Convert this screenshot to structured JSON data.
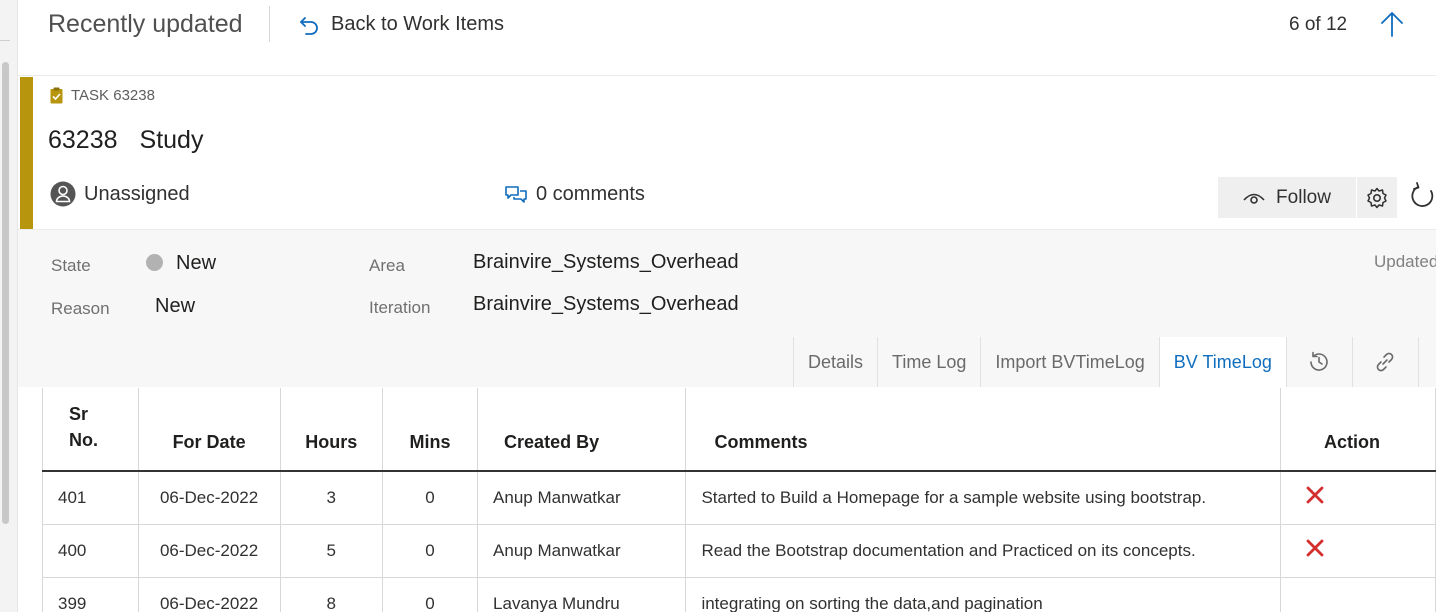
{
  "header": {
    "title": "Recently updated",
    "back_label": "Back to Work Items",
    "counter": "6 of 12"
  },
  "work_item": {
    "type_label": "TASK 63238",
    "id": "63238",
    "title": "Study",
    "assignee": "Unassigned",
    "comments": "0 comments",
    "follow_label": "Follow"
  },
  "fields": {
    "state_label": "State",
    "state_value": "New",
    "reason_label": "Reason",
    "reason_value": "New",
    "area_label": "Area",
    "area_value": "Brainvire_Systems_Overhead",
    "iteration_label": "Iteration",
    "iteration_value": "Brainvire_Systems_Overhead",
    "updated_label": "Updated"
  },
  "tabs": [
    {
      "label": "Details"
    },
    {
      "label": "Time Log"
    },
    {
      "label": "Import BVTimeLog"
    },
    {
      "label": "BV TimeLog",
      "active": true
    }
  ],
  "table": {
    "headers": {
      "sr_line1": "Sr",
      "sr_line2": "No.",
      "date": "For Date",
      "hours": "Hours",
      "mins": "Mins",
      "created_by": "Created By",
      "comments": "Comments",
      "action": "Action"
    },
    "rows": [
      {
        "sr": "401",
        "date": "06-Dec-2022",
        "hours": "3",
        "mins": "0",
        "created_by": "Anup Manwatkar",
        "comments": "Started to Build a Homepage for a sample website using bootstrap."
      },
      {
        "sr": "400",
        "date": "06-Dec-2022",
        "hours": "5",
        "mins": "0",
        "created_by": "Anup Manwatkar",
        "comments": "Read the Bootstrap documentation and Practiced on its concepts."
      },
      {
        "sr": "399",
        "date": "06-Dec-2022",
        "hours": "8",
        "mins": "0",
        "created_by": "Lavanya Mundru",
        "comments": "integrating on sorting the data,and pagination"
      }
    ]
  },
  "colors": {
    "task_accent": "#b7960e",
    "link_blue": "#0f6cbd",
    "delete_red": "#d32f2f"
  },
  "icons": {
    "back": "back-arrow-icon",
    "up": "up-arrow-icon",
    "task": "task-clipboard-icon",
    "assignee": "user-avatar-icon",
    "comments": "comments-icon",
    "follow": "eye-icon",
    "settings": "gear-icon",
    "refresh": "refresh-icon",
    "history": "history-icon",
    "links": "link-icon",
    "delete": "delete-x-icon"
  }
}
